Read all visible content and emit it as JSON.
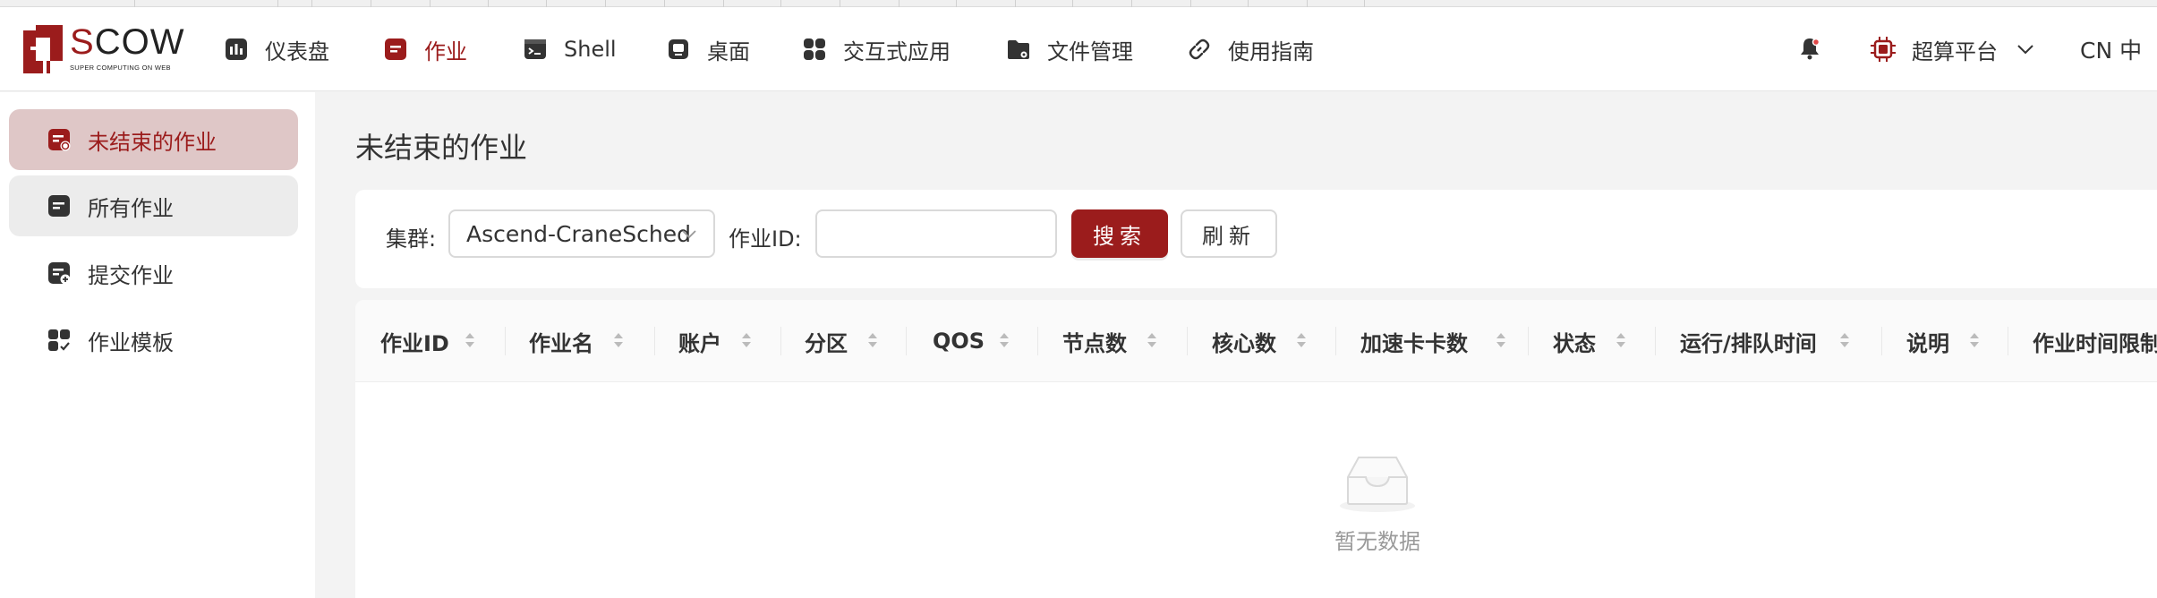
{
  "app": {
    "logo_text_primary": "S",
    "logo_text_rest": "COW",
    "logo_tagline": "SUPER COMPUTING ON WEB"
  },
  "nav": {
    "items": [
      {
        "label": "仪表盘",
        "icon": "dashboard-icon",
        "active": false
      },
      {
        "label": "作业",
        "icon": "job-icon",
        "active": true
      },
      {
        "label": "Shell",
        "icon": "terminal-icon",
        "active": false
      },
      {
        "label": "桌面",
        "icon": "desktop-icon",
        "active": false
      },
      {
        "label": "交互式应用",
        "icon": "apps-grid-icon",
        "active": false
      },
      {
        "label": "文件管理",
        "icon": "folder-icon",
        "active": false
      },
      {
        "label": "使用指南",
        "icon": "link-icon",
        "active": false
      }
    ],
    "platform_label": "超算平台",
    "lang_label": "CN 中"
  },
  "sidebar": {
    "items": [
      {
        "label": "未结束的作业",
        "icon": "running-job-icon",
        "state": "active"
      },
      {
        "label": "所有作业",
        "icon": "all-jobs-icon",
        "state": "hover"
      },
      {
        "label": "提交作业",
        "icon": "submit-job-icon",
        "state": "normal"
      },
      {
        "label": "作业模板",
        "icon": "job-template-icon",
        "state": "normal"
      }
    ]
  },
  "main": {
    "title": "未结束的作业",
    "filters": {
      "cluster_label": "集群:",
      "cluster_value": "Ascend-CraneSched",
      "job_id_label": "作业ID:",
      "job_id_value": "",
      "search_button": "搜索",
      "refresh_button": "刷新"
    },
    "table": {
      "columns": [
        "作业ID",
        "作业名",
        "账户",
        "分区",
        "QOS",
        "节点数",
        "核心数",
        "加速卡卡数",
        "状态",
        "运行/排队时间",
        "说明",
        "作业时间限制"
      ],
      "rows": [],
      "empty_text": "暂无数据"
    }
  },
  "colors": {
    "brand": "#9b1c1c",
    "active_bg": "#dfc7c7",
    "page_bg": "#f3f3f3"
  }
}
